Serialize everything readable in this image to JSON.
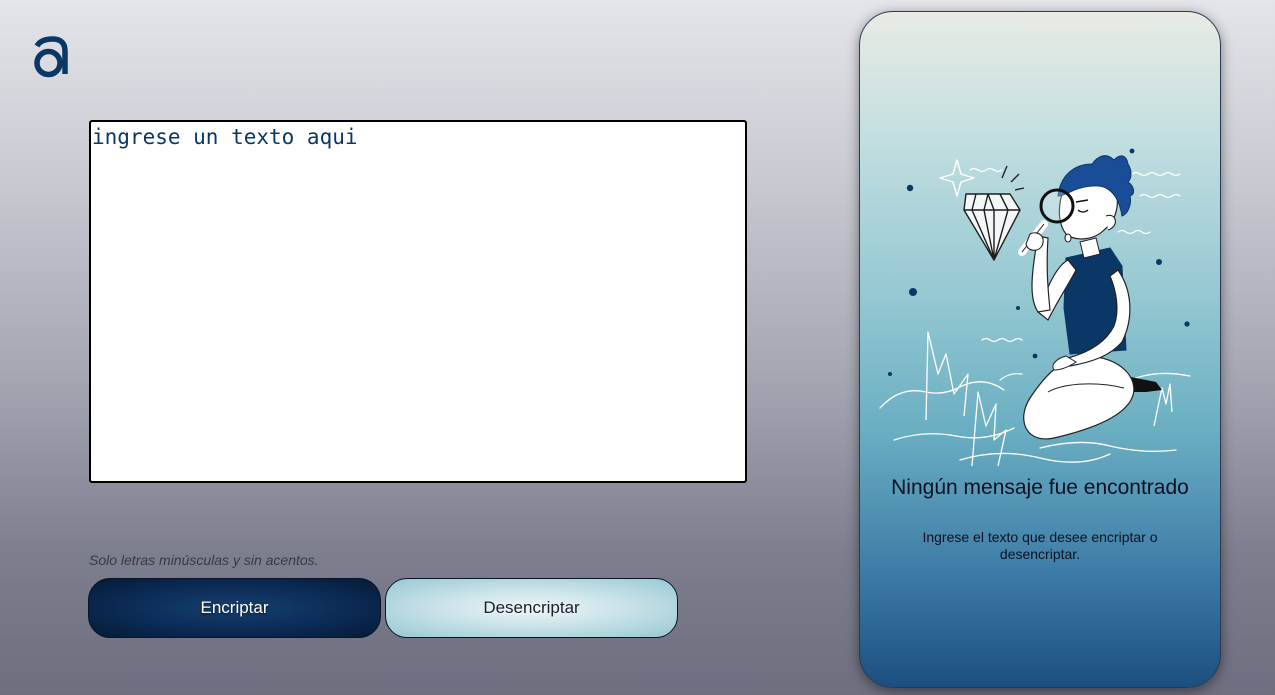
{
  "app": {
    "logo_icon": "alura-a-logo-icon",
    "brand_color": "#0b3766"
  },
  "input": {
    "value": "",
    "placeholder": "ingrese un texto aqui"
  },
  "hint": {
    "text": "Solo letras minúsculas y sin acentos."
  },
  "buttons": {
    "encrypt_label": "Encriptar",
    "decrypt_label": "Desencriptar"
  },
  "output_panel": {
    "illustration": "boy-with-magnifying-glass-and-diamond-illustration",
    "title": "Ningún mensaje fue encontrado",
    "description": "Ingrese el texto que desee encriptar o desencriptar."
  },
  "colors": {
    "encrypt_button": "#0b2b55",
    "decrypt_button": "#c9e3e8",
    "panel_top": "#e9ebe4",
    "panel_bottom": "#1c4f80"
  }
}
